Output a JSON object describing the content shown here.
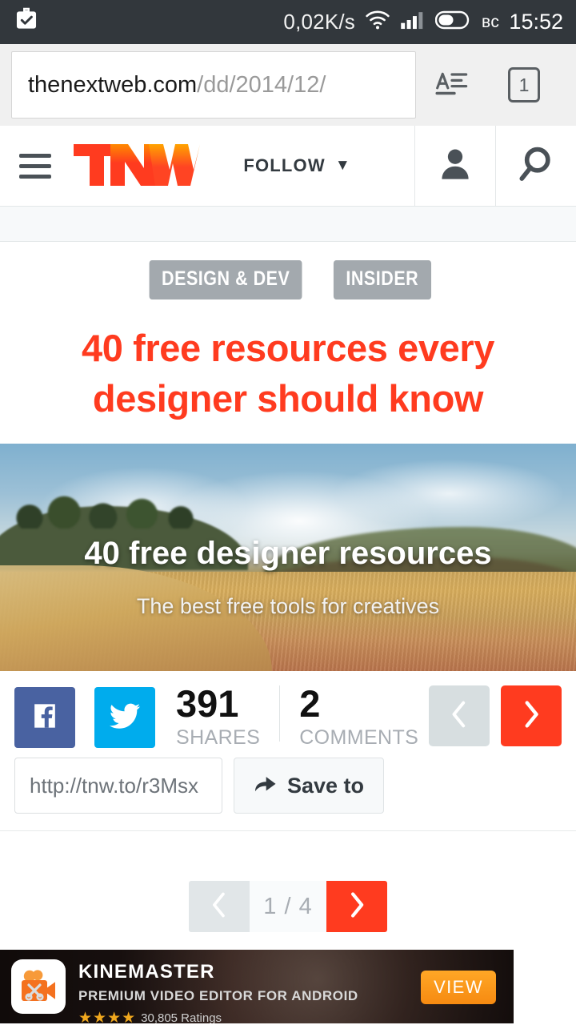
{
  "statusbar": {
    "left_icon": "briefcase-check-icon",
    "network_speed": "0,02K/s",
    "wifi_icon": "wifi-icon",
    "signal_icon": "cellular-signal-icon",
    "battery_icon": "battery-icon",
    "day": "вс",
    "time": "15:52"
  },
  "browser": {
    "url_host": "thenextweb.com",
    "url_path": "/dd/2014/12/",
    "reader_icon": "reader-mode-icon",
    "tab_count": "1"
  },
  "site_header": {
    "menu_icon": "hamburger-menu-icon",
    "logo_text": "TNW",
    "follow_label": "FOLLOW",
    "caret_icon": "chevron-down-icon",
    "account_icon": "user-account-icon",
    "search_icon": "search-icon"
  },
  "article": {
    "tags": [
      "DESIGN & DEV",
      "INSIDER"
    ],
    "title": "40 free resources every designer should know",
    "hero": {
      "overlay_title": "40 free designer resources",
      "overlay_subtitle": "The best free tools for creatives"
    }
  },
  "share": {
    "facebook_icon": "facebook-icon",
    "twitter_icon": "twitter-icon",
    "shares_count": "391",
    "shares_label": "SHARES",
    "comments_count": "2",
    "comments_label": "COMMENTS",
    "prev_icon": "chevron-left-icon",
    "next_icon": "chevron-right-icon",
    "short_url": "http://tnw.to/r3Msx",
    "save_icon": "share-arrow-icon",
    "save_label": "Save to"
  },
  "pagination": {
    "prev_icon": "chevron-left-icon",
    "page_label": "1 / 4",
    "next_icon": "chevron-right-icon"
  },
  "ad": {
    "app_icon": "kinemaster-video-camera-icon",
    "title": "KINEMASTER",
    "subtitle": "PREMIUM VIDEO EDITOR FOR ANDROID",
    "stars": "★★★★",
    "ratings": "30,805 Ratings",
    "cta_label": "VIEW"
  },
  "colors": {
    "accent_red": "#ff3b1f",
    "statusbar_bg": "#32373c",
    "tag_gray": "#a3a9ae",
    "facebook_blue": "#4962a1",
    "twitter_blue": "#00aced",
    "ad_orange": "#f68a11"
  }
}
